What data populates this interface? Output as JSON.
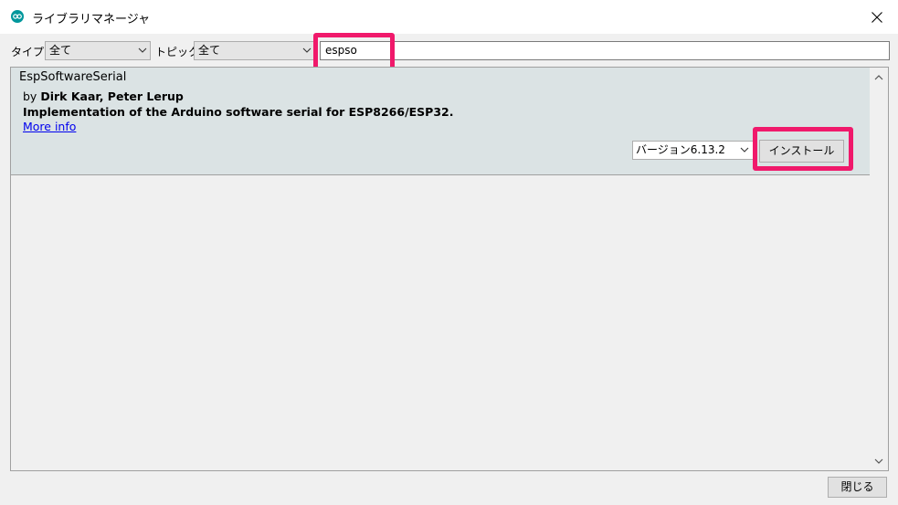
{
  "window": {
    "title": "ライブラリマネージャ",
    "close_icon": "close-icon",
    "app_icon": "arduino-logo-icon",
    "accent_color": "#00979c"
  },
  "toolbar": {
    "type_label": "タイプ",
    "type_value": "全て",
    "topic_label": "トピック",
    "topic_value": "全て",
    "search_value": "espso"
  },
  "library": {
    "name": "EspSoftwareSerial",
    "author_prefix": "by",
    "authors": "Dirk Kaar, Peter Lerup",
    "description": "Implementation of the Arduino software serial for ESP8266/ESP32.",
    "more_info": "More info",
    "version_value": "バージョン6.13.2",
    "install_label": "インストール"
  },
  "footer": {
    "close_label": "閉じる"
  },
  "highlight_color": "#f0196b"
}
